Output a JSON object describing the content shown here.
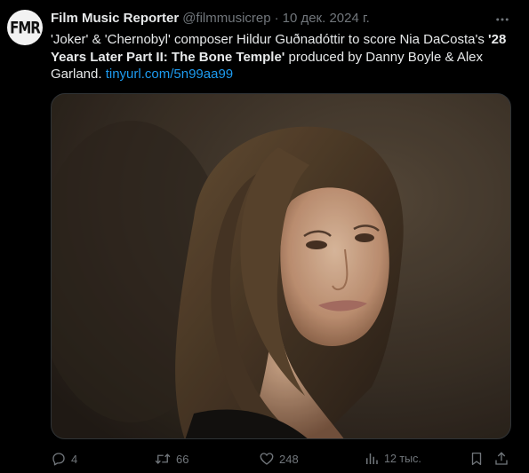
{
  "author": {
    "avatar_text": "FMR",
    "name": "Film Music Reporter",
    "handle": "@filmmusicrep",
    "separator": "·",
    "date": "10 дек. 2024 г."
  },
  "tweet": {
    "text_part1": "'Joker' & 'Chernobyl' composer Hildur Guðnadóttir to score Nia DaCosta's ",
    "text_bold": "'28 Years Later Part II: The Bone Temple'",
    "text_part2": " produced by Danny Boyle & Alex Garland. ",
    "link": "tinyurl.com/5n99aa99"
  },
  "actions": {
    "replies": "4",
    "reposts": "66",
    "likes": "248",
    "views": "12 тыс."
  },
  "colors": {
    "background": "#000000",
    "text": "#e7e9ea",
    "muted": "#71767b",
    "link": "#1d9bf0"
  }
}
